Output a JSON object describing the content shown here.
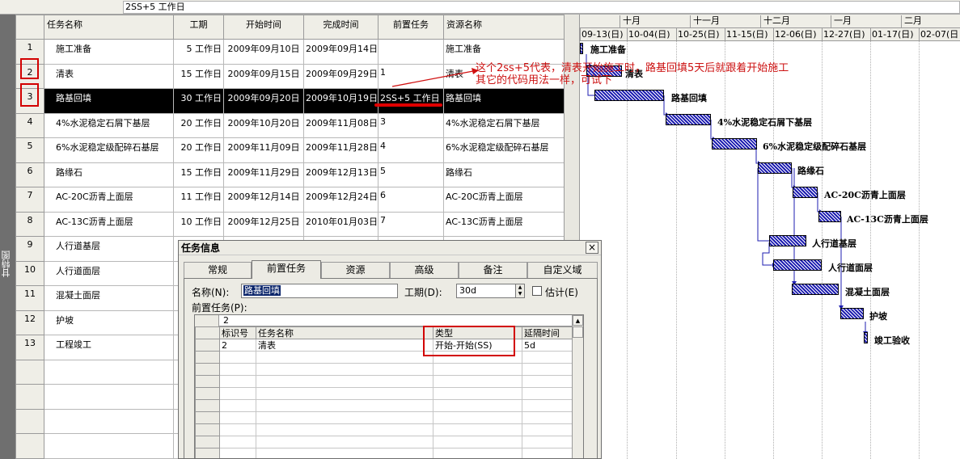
{
  "entry_bar": {
    "value": "2SS+5 工作日"
  },
  "view_bar": {
    "label": "甘特图"
  },
  "grid": {
    "columns": [
      "任务名称",
      "工期",
      "开始时间",
      "完成时间",
      "前置任务",
      "资源名称"
    ],
    "rows": [
      {
        "id": "1",
        "name": "施工准备",
        "duration": "5 工作日",
        "start": "2009年09月10日",
        "finish": "2009年09月14日",
        "pred": "",
        "resource": "施工准备"
      },
      {
        "id": "2",
        "name": "清表",
        "duration": "15 工作日",
        "start": "2009年09月15日",
        "finish": "2009年09月29日",
        "pred": "1",
        "resource": "清表"
      },
      {
        "id": "3",
        "name": "路基回填",
        "duration": "30 工作日",
        "start": "2009年09月20日",
        "finish": "2009年10月19日",
        "pred": "2SS+5 工作日",
        "resource": "路基回填"
      },
      {
        "id": "4",
        "name": "4%水泥稳定石屑下基层",
        "duration": "20 工作日",
        "start": "2009年10月20日",
        "finish": "2009年11月08日",
        "pred": "3",
        "resource": "4%水泥稳定石屑下基层"
      },
      {
        "id": "5",
        "name": "6%水泥稳定级配碎石基层",
        "duration": "20 工作日",
        "start": "2009年11月09日",
        "finish": "2009年11月28日",
        "pred": "4",
        "resource": "6%水泥稳定级配碎石基层"
      },
      {
        "id": "6",
        "name": "路缘石",
        "duration": "15 工作日",
        "start": "2009年11月29日",
        "finish": "2009年12月13日",
        "pred": "5",
        "resource": "路缘石"
      },
      {
        "id": "7",
        "name": "AC-20C沥青上面层",
        "duration": "11 工作日",
        "start": "2009年12月14日",
        "finish": "2009年12月24日",
        "pred": "6",
        "resource": "AC-20C沥青上面层"
      },
      {
        "id": "8",
        "name": "AC-13C沥青上面层",
        "duration": "10 工作日",
        "start": "2009年12月25日",
        "finish": "2010年01月03日",
        "pred": "7",
        "resource": "AC-13C沥青上面层"
      },
      {
        "id": "9",
        "name": "人行道基层",
        "duration": "",
        "start": "",
        "finish": "",
        "pred": "",
        "resource": ""
      },
      {
        "id": "10",
        "name": "人行道面层",
        "duration": "",
        "start": "",
        "finish": "",
        "pred": "",
        "resource": ""
      },
      {
        "id": "11",
        "name": "混凝土面层",
        "duration": "",
        "start": "",
        "finish": "",
        "pred": "",
        "resource": ""
      },
      {
        "id": "12",
        "name": "护坡",
        "duration": "",
        "start": "",
        "finish": "",
        "pred": "",
        "resource": ""
      },
      {
        "id": "13",
        "name": "工程竣工",
        "duration": "",
        "start": "",
        "finish": "",
        "pred": "",
        "resource": ""
      },
      {
        "id": "",
        "name": "",
        "duration": "",
        "start": "",
        "finish": "",
        "pred": "",
        "resource": ""
      },
      {
        "id": "",
        "name": "",
        "duration": "",
        "start": "",
        "finish": "",
        "pred": "",
        "resource": ""
      },
      {
        "id": "",
        "name": "",
        "duration": "",
        "start": "",
        "finish": "",
        "pred": "",
        "resource": ""
      },
      {
        "id": "",
        "name": "",
        "duration": "",
        "start": "",
        "finish": "",
        "pred": "",
        "resource": ""
      }
    ]
  },
  "gantt": {
    "months": [
      "十月",
      "十一月",
      "十二月",
      "一月",
      "二月"
    ],
    "weeks": [
      "09-13(日)",
      "10-04(日)",
      "10-25(日)",
      "11-15(日)",
      "12-06(日)",
      "12-27(日)",
      "01-17(日)",
      "02-07(日"
    ],
    "labels": [
      "施工准备",
      "清表",
      "路基回填",
      "4%水泥稳定石屑下基层",
      "6%水泥稳定级配碎石基层",
      "路缘石",
      "AC-20C沥青上面层",
      "AC-13C沥青上面层",
      "人行道基层",
      "人行道面层",
      "混凝土面层",
      "护坡",
      "竣工验收"
    ]
  },
  "annotation": {
    "line1": "这个2ss+5代表，清表开始施工时，路基回填5天后就跟着开始施工",
    "line2": "其它的代码用法一样，可试下"
  },
  "dialog": {
    "title": "任务信息",
    "close": "×",
    "tabs": [
      "常规",
      "前置任务",
      "资源",
      "高级",
      "备注",
      "自定义域"
    ],
    "active_tab": "前置任务",
    "name_label": "名称(N):",
    "name_value": "路基回填",
    "duration_label": "工期(D):",
    "duration_value": "30d",
    "estimate_label": "估计(E)",
    "pred_label": "前置任务(P):",
    "edit_value": "2",
    "columns": [
      "标识号",
      "任务名称",
      "类型",
      "延隔时间"
    ],
    "rows": [
      {
        "id": "2",
        "name": "清表",
        "type": "开始-开始(SS)",
        "lag": "5d"
      }
    ]
  }
}
